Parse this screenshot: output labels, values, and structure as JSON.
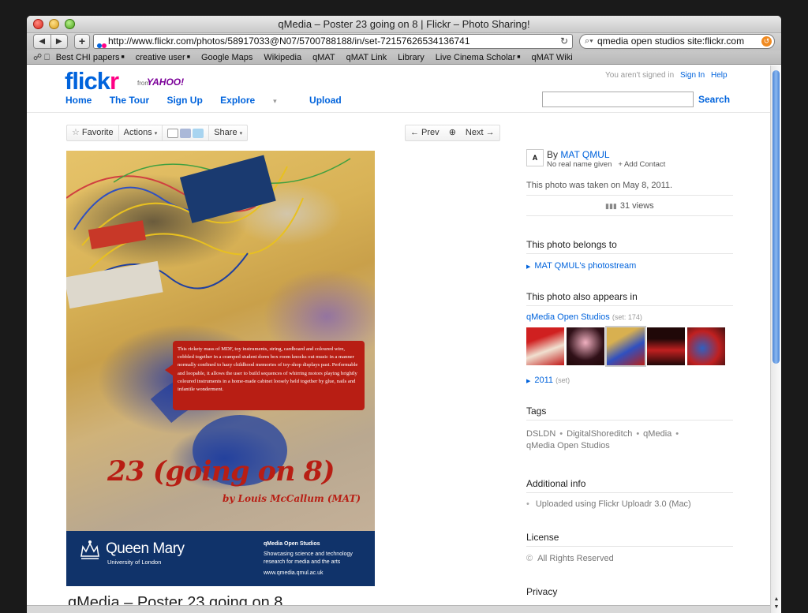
{
  "browser": {
    "window_title": "qMedia – Poster 23 going on 8 | Flickr – Photo Sharing!",
    "back": "◀",
    "forward": "▶",
    "add": "+",
    "url": "http://www.flickr.com/photos/58917033@N07/5700788188/in/set-72157626534136741",
    "reload": "↻",
    "search_value": "qmedia open studios site:flickr.com",
    "search_icon": "⌕▾",
    "clear_icon": "↺",
    "bookmarks_icons": "☍  ⎕",
    "bookmarks": [
      {
        "label": "Best CHI papers",
        "folder": true
      },
      {
        "label": "creative user",
        "folder": true
      },
      {
        "label": "Google Maps",
        "folder": false
      },
      {
        "label": "Wikipedia",
        "folder": false
      },
      {
        "label": "qMAT",
        "folder": false
      },
      {
        "label": "qMAT Link",
        "folder": false
      },
      {
        "label": "Library",
        "folder": false
      },
      {
        "label": "Live Cinema Scholar",
        "folder": true
      },
      {
        "label": "qMAT Wiki",
        "folder": false
      }
    ]
  },
  "header": {
    "logo_flick": "flick",
    "logo_r": "r",
    "logo_from": "from",
    "logo_yahoo": "YAHOO!",
    "signed_status": "You aren't signed in",
    "sign_in": "Sign In",
    "help": "Help",
    "nav": {
      "home": "Home",
      "tour": "The Tour",
      "signup": "Sign Up",
      "explore": "Explore",
      "upload": "Upload"
    },
    "search_button": "Search",
    "search_placeholder": ""
  },
  "actions": {
    "favorite": "Favorite",
    "actions": "Actions",
    "share": "Share",
    "prev": "← Prev",
    "next": "Next →"
  },
  "poster": {
    "callout": "This rickety mass of MDF, toy instruments, string, cardboard and coloured wire, cobbled together in a cramped student dorm box room knocks out music in a manner normally confined to hazy childhood memories of toy-shop displays past. Performable and loopable, it allows the user to build sequences of whirring motors playing brightly coloured instruments in a home-made cabinet loosely held together by glue, nails and infantile wonderment.",
    "title": "23 (going on 8)",
    "byline": "by Louis McCallum (MAT)",
    "qm_name": "Queen Mary",
    "qm_sub": "University of London",
    "qmedia_title": "qMedia Open Studios",
    "qmedia_desc": "Showcasing science and technology research for media and the arts",
    "qmedia_url": "www.qmedia.qmul.ac.uk"
  },
  "photo_caption": "qMedia – Poster 23 going on 8",
  "sidebar": {
    "buddy_letters": "A",
    "by_prefix": "By ",
    "owner": "MAT QMUL",
    "real_name": "No real name given",
    "add_contact": "+ Add Contact",
    "taken": "This photo was taken on May 8, 2011.",
    "views": "31 views",
    "belongs_heading": "This photo belongs to",
    "photostream": "MAT QMUL's photostream",
    "appears_heading": "This photo also appears in",
    "set_name": "qMedia Open Studios",
    "set_count": "(set: 174)",
    "year_set": "2011",
    "year_set_suffix": "(set)",
    "tags_heading": "Tags",
    "tags": [
      "DSLDN",
      "DigitalShoreditch",
      "qMedia",
      "qMedia Open Studios"
    ],
    "additional_heading": "Additional info",
    "uploaded": "Uploaded using Flickr Uploadr 3.0 (Mac)",
    "license_heading": "License",
    "license": "All Rights Reserved",
    "privacy_heading": "Privacy"
  },
  "colors": {
    "flickr_blue": "#0063dc",
    "flickr_pink": "#ff0084",
    "poster_red": "#b81e14",
    "qm_navy": "#10336a"
  }
}
